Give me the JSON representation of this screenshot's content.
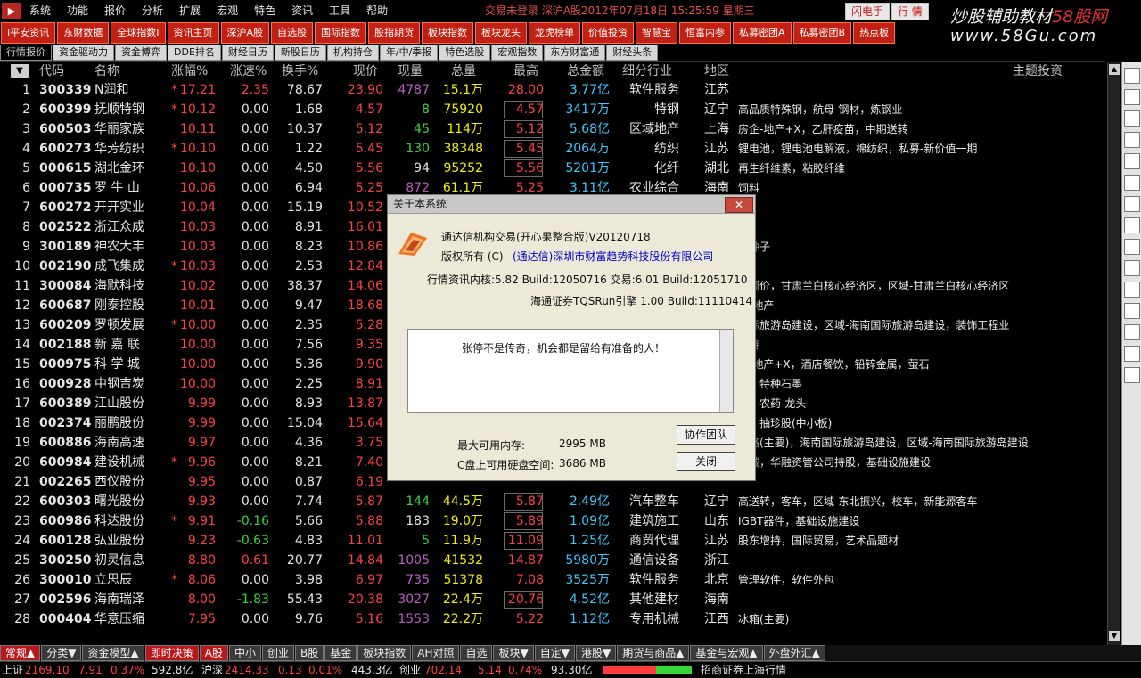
{
  "menu": [
    "系统",
    "功能",
    "报价",
    "分析",
    "扩展",
    "宏观",
    "特色",
    "资讯",
    "工具",
    "帮助"
  ],
  "status_text": "交易未登录  深沪A股2012年07月18日 15:25:59 星期三",
  "flash_btn": "闪电手",
  "quote_btn": "行 情",
  "watermark": {
    "text": "炒股辅助教材",
    "accent": "58股网",
    "url": "www.58Gu.com"
  },
  "toolbar": [
    "I平安资讯",
    "东财数据",
    "全球指数I",
    "资讯主页",
    "深沪A股",
    "自选股",
    "国际指数",
    "股指期货",
    "板块指数",
    "板块龙头",
    "龙虎榜单",
    "价值投资",
    "智慧宝",
    "恒富内参",
    "私募密团A",
    "私募密团B",
    "热点板"
  ],
  "tabs": [
    "行情报价",
    "资金驱动力",
    "资金博弈",
    "DDE排名",
    "财经日历",
    "新股日历",
    "机构持仓",
    "年/中/季报",
    "特色选股",
    "宏观指数",
    "东方财富通",
    "财经头条"
  ],
  "headers": [
    "代码",
    "名称",
    "涨幅%",
    "涨速%",
    "换手%",
    "现价",
    "现量",
    "总量",
    "最高",
    "总金额",
    "细分行业",
    "地区",
    "主题投资"
  ],
  "rows": [
    {
      "i": "1",
      "code": "300339",
      "name": "N润和",
      "star": "*",
      "chg": "17.21",
      "spd": "2.35",
      "turn": "78.67",
      "price": "23.90",
      "vol": "4787",
      "tvol": "15.1万",
      "high": "28.00",
      "amt": "3.77亿",
      "ind": "软件服务",
      "area": "江苏",
      "theme": "",
      "vc": "purple"
    },
    {
      "i": "2",
      "code": "600399",
      "name": "抚顺特钢",
      "star": "*",
      "chg": "10.12",
      "spd": "0.00",
      "turn": "1.68",
      "price": "4.57",
      "vol": "8",
      "tvol": "75920",
      "high": "4.57",
      "amt": "3417万",
      "ind": "特钢",
      "area": "辽宁",
      "theme": "高品质特殊钢，航母-钢材，炼钢业",
      "vc": "green"
    },
    {
      "i": "3",
      "code": "600503",
      "name": "华丽家族",
      "star": "",
      "chg": "10.11",
      "spd": "0.00",
      "turn": "10.37",
      "price": "5.12",
      "vol": "45",
      "tvol": "114万",
      "high": "5.12",
      "amt": "5.68亿",
      "ind": "区域地产",
      "area": "上海",
      "theme": "房企-地产+X，乙肝疫苗，中期送转",
      "vc": "green"
    },
    {
      "i": "4",
      "code": "600273",
      "name": "华芳纺织",
      "star": "*",
      "chg": "10.10",
      "spd": "0.00",
      "turn": "1.22",
      "price": "5.45",
      "vol": "130",
      "tvol": "38348",
      "high": "5.45",
      "amt": "2064万",
      "ind": "纺织",
      "area": "江苏",
      "theme": "锂电池，锂电池电解液，棉纺织，私募-新价值一期",
      "vc": "green"
    },
    {
      "i": "5",
      "code": "000615",
      "name": "湖北金环",
      "star": "",
      "chg": "10.10",
      "spd": "0.00",
      "turn": "4.50",
      "price": "5.56",
      "vol": "94",
      "tvol": "95252",
      "high": "5.56",
      "amt": "5201万",
      "ind": "化纤",
      "area": "湖北",
      "theme": "再生纤维素，粘胶纤维",
      "vc": "white"
    },
    {
      "i": "6",
      "code": "000735",
      "name": "罗 牛 山",
      "star": "",
      "chg": "10.06",
      "spd": "0.00",
      "turn": "6.94",
      "price": "5.25",
      "vol": "872",
      "tvol": "61.1万",
      "high": "5.25",
      "amt": "3.11亿",
      "ind": "农业综合",
      "area": "海南",
      "theme": "饲料",
      "vc": "purple"
    },
    {
      "i": "7",
      "code": "600272",
      "name": "开开实业",
      "star": "",
      "chg": "10.04",
      "spd": "0.00",
      "turn": "15.19",
      "price": "10.52",
      "vol": "",
      "tvol": "",
      "high": "",
      "amt": "",
      "ind": "",
      "area": "",
      "theme": "",
      "vc": "white"
    },
    {
      "i": "8",
      "code": "002522",
      "name": "浙江众成",
      "star": "",
      "chg": "10.03",
      "spd": "0.00",
      "turn": "8.91",
      "price": "16.01",
      "vol": "",
      "tvol": "",
      "high": "",
      "amt": "",
      "ind": "",
      "area": "",
      "theme": "",
      "vc": "white"
    },
    {
      "i": "9",
      "code": "300189",
      "name": "神农大丰",
      "star": "",
      "chg": "10.03",
      "spd": "0.00",
      "turn": "8.23",
      "price": "10.86",
      "vol": "",
      "tvol": "",
      "high": "",
      "amt": "",
      "ind": "",
      "area": "",
      "theme": "，种子",
      "vc": "white"
    },
    {
      "i": "10",
      "code": "002190",
      "name": "成飞集成",
      "star": "*",
      "chg": "10.03",
      "spd": "0.00",
      "turn": "2.53",
      "price": "12.84",
      "vol": "",
      "tvol": "",
      "high": "",
      "amt": "",
      "ind": "",
      "area": "",
      "theme": "池",
      "vc": "white"
    },
    {
      "i": "11",
      "code": "300084",
      "name": "海默科技",
      "star": "",
      "chg": "10.02",
      "spd": "0.00",
      "turn": "38.37",
      "price": "14.06",
      "vol": "",
      "tvol": "",
      "high": "",
      "amt": "",
      "ind": "",
      "area": "",
      "theme": "油调价，甘肃兰白核心经济区，区域-甘肃兰白核心经济区",
      "vc": "white"
    },
    {
      "i": "12",
      "code": "600687",
      "name": "刚泰控股",
      "star": "",
      "chg": "10.01",
      "spd": "0.00",
      "turn": "9.47",
      "price": "18.68",
      "vol": "",
      "tvol": "",
      "high": "",
      "amt": "",
      "ind": "",
      "area": "",
      "theme": "企-地产",
      "vc": "white"
    },
    {
      "i": "13",
      "code": "600209",
      "name": "罗顿发展",
      "star": "*",
      "chg": "10.00",
      "spd": "0.00",
      "turn": "2.35",
      "price": "5.28",
      "vol": "",
      "tvol": "",
      "high": "",
      "amt": "",
      "ind": "",
      "area": "",
      "theme": "国际旅游岛建设，区域-海南国际旅游岛建设，装饰工程业",
      "vc": "white"
    },
    {
      "i": "14",
      "code": "002188",
      "name": "新 嘉 联",
      "star": "",
      "chg": "10.00",
      "spd": "0.00",
      "turn": "7.56",
      "price": "9.35",
      "vol": "",
      "tvol": "",
      "high": "",
      "amt": "",
      "ind": "",
      "area": "",
      "theme": "增持",
      "vc": "white"
    },
    {
      "i": "15",
      "code": "000975",
      "name": "科 学 城",
      "star": "",
      "chg": "10.00",
      "spd": "0.00",
      "turn": "5.36",
      "price": "9.90",
      "vol": "",
      "tvol": "",
      "high": "",
      "amt": "",
      "ind": "",
      "area": "",
      "theme": "企-地产+X，酒店餐饮，铅锌金属，萤石",
      "vc": "white"
    },
    {
      "i": "16",
      "code": "000928",
      "name": "中钢吉炭",
      "star": "",
      "chg": "10.00",
      "spd": "0.00",
      "turn": "2.25",
      "price": "8.91",
      "vol": "",
      "tvol": "",
      "high": "",
      "amt": "",
      "ind": "",
      "area": "",
      "theme": "维，特种石墨",
      "vc": "white"
    },
    {
      "i": "17",
      "code": "600389",
      "name": "江山股份",
      "star": "",
      "chg": "9.99",
      "spd": "0.00",
      "turn": "8.93",
      "price": "13.87",
      "vol": "",
      "tvol": "",
      "high": "",
      "amt": "",
      "ind": "",
      "area": "",
      "theme": "膦，农药-龙头",
      "vc": "white"
    },
    {
      "i": "18",
      "code": "002374",
      "name": "丽鹏股份",
      "star": "",
      "chg": "9.99",
      "spd": "0.00",
      "turn": "15.04",
      "price": "15.64",
      "vol": "",
      "tvol": "",
      "high": "",
      "amt": "",
      "ind": "",
      "area": "",
      "theme": "属，抽珍股(中小板)",
      "vc": "white"
    },
    {
      "i": "19",
      "code": "600886",
      "name": "海南高速",
      "star": "",
      "chg": "9.97",
      "spd": "0.00",
      "turn": "4.36",
      "price": "3.75",
      "vol": "",
      "tvol": "",
      "high": "",
      "amt": "",
      "ind": "",
      "area": "",
      "theme": "公路(主要)，海南国际旅游岛建设，区域-海南国际旅游岛建设",
      "vc": "white"
    },
    {
      "i": "20",
      "code": "600984",
      "name": "建设机械",
      "star": "*",
      "chg": "9.96",
      "spd": "0.00",
      "turn": "8.21",
      "price": "7.40",
      "vol": "",
      "tvol": "",
      "high": "",
      "amt": "",
      "ind": "",
      "area": "",
      "theme": "机械，华融资管公司持股，基础设施建设",
      "vc": "white"
    },
    {
      "i": "21",
      "code": "002265",
      "name": "西仪股份",
      "star": "",
      "chg": "9.95",
      "spd": "0.00",
      "turn": "0.87",
      "price": "6.19",
      "vol": "",
      "tvol": "",
      "high": "",
      "amt": "",
      "ind": "",
      "area": "",
      "theme": "",
      "vc": "white"
    },
    {
      "i": "22",
      "code": "600303",
      "name": "曙光股份",
      "star": "",
      "chg": "9.93",
      "spd": "0.00",
      "turn": "7.74",
      "price": "5.87",
      "vol": "144",
      "tvol": "44.5万",
      "high": "5.87",
      "amt": "2.49亿",
      "ind": "汽车整车",
      "area": "辽宁",
      "theme": "高送转，客车，区域-东北振兴，校车，新能源客车",
      "vc": "green"
    },
    {
      "i": "23",
      "code": "600986",
      "name": "科达股份",
      "star": "*",
      "chg": "9.91",
      "spd": "-0.16",
      "turn": "5.66",
      "price": "5.88",
      "vol": "183",
      "tvol": "19.0万",
      "high": "5.89",
      "amt": "1.09亿",
      "ind": "建筑施工",
      "area": "山东",
      "theme": "IGBT器件，基础设施建设",
      "vc": "white"
    },
    {
      "i": "24",
      "code": "600128",
      "name": "弘业股份",
      "star": "",
      "chg": "9.23",
      "spd": "-0.63",
      "turn": "4.83",
      "price": "11.01",
      "vol": "5",
      "tvol": "11.9万",
      "high": "11.09",
      "amt": "1.25亿",
      "ind": "商贸代理",
      "area": "江苏",
      "theme": "股东增持，国际贸易，艺术品题材",
      "vc": "green"
    },
    {
      "i": "25",
      "code": "300250",
      "name": "初灵信息",
      "star": "",
      "chg": "8.80",
      "spd": "0.61",
      "turn": "20.77",
      "price": "14.84",
      "vol": "1005",
      "tvol": "41532",
      "high": "14.87",
      "amt": "5980万",
      "ind": "通信设备",
      "area": "浙江",
      "theme": "",
      "vc": "purple"
    },
    {
      "i": "26",
      "code": "300010",
      "name": "立思辰",
      "star": "*",
      "chg": "8.06",
      "spd": "0.00",
      "turn": "3.98",
      "price": "6.97",
      "vol": "735",
      "tvol": "51378",
      "high": "7.08",
      "amt": "3525万",
      "ind": "软件服务",
      "area": "北京",
      "theme": "管理软件，软件外包",
      "vc": "purple"
    },
    {
      "i": "27",
      "code": "002596",
      "name": "海南瑞泽",
      "star": "",
      "chg": "8.00",
      "spd": "-1.83",
      "turn": "55.43",
      "price": "20.38",
      "vol": "3027",
      "tvol": "22.4万",
      "high": "20.76",
      "amt": "4.52亿",
      "ind": "其他建材",
      "area": "海南",
      "theme": "",
      "vc": "purple"
    },
    {
      "i": "28",
      "code": "000404",
      "name": "华意压缩",
      "star": "",
      "chg": "7.95",
      "spd": "0.00",
      "turn": "9.76",
      "price": "5.16",
      "vol": "1553",
      "tvol": "22.2万",
      "high": "5.22",
      "amt": "1.12亿",
      "ind": "专用机械",
      "area": "江西",
      "theme": "冰箱(主要)",
      "vc": "purple"
    }
  ],
  "bottom_tabs": [
    "常规▲",
    "分类▼",
    "资金模型▲",
    "即时决策",
    "A股",
    "中小",
    "创业",
    "B股",
    "基金",
    "板块指数",
    "AH对照",
    "自选",
    "板块▼",
    "自定▼",
    "港股▼",
    "期货与商品▲",
    "基金与宏观▲",
    "外盘外汇▲"
  ],
  "index_bar": {
    "sh_label": "上证",
    "sh_val": "2169.10",
    "sh_chg": "7.91",
    "sh_pct": "0.37%",
    "sh_amt": "592.8亿",
    "sz_label": "沪深",
    "sz_val": "2414.33",
    "sz_chg": "0.13",
    "sz_pct": "0.01%",
    "sz_amt": "443.3亿",
    "cy_label": "创业",
    "cy_val": "702.14",
    "cy_chg": "5.14",
    "cy_pct": "0.74%",
    "cy_amt": "93.30亿",
    "broker": "招商证券上海行情"
  },
  "dialog": {
    "title": "关于本系统",
    "close": "✕",
    "product": "通达信机构交易(开心果整合版)V20120718",
    "copyright_label": "版权所有 (C)",
    "company": "(通达信)深圳市财富趋势科技股份有限公司",
    "version": "行情资讯内核:5.82 Build:12050716 交易:6.01 Build:12051710",
    "engine": "海通证券TQSRun引擎 1.00 Build:11110414",
    "message": "张停不是传奇，机会都是留给有准备的人！",
    "mem_label": "最大可用内存:",
    "mem_val": "2995 MB",
    "disk_label": "C盘上可用硬盘空间:",
    "disk_val": "3686 MB",
    "team_btn": "协作团队",
    "close_btn": "关闭"
  }
}
